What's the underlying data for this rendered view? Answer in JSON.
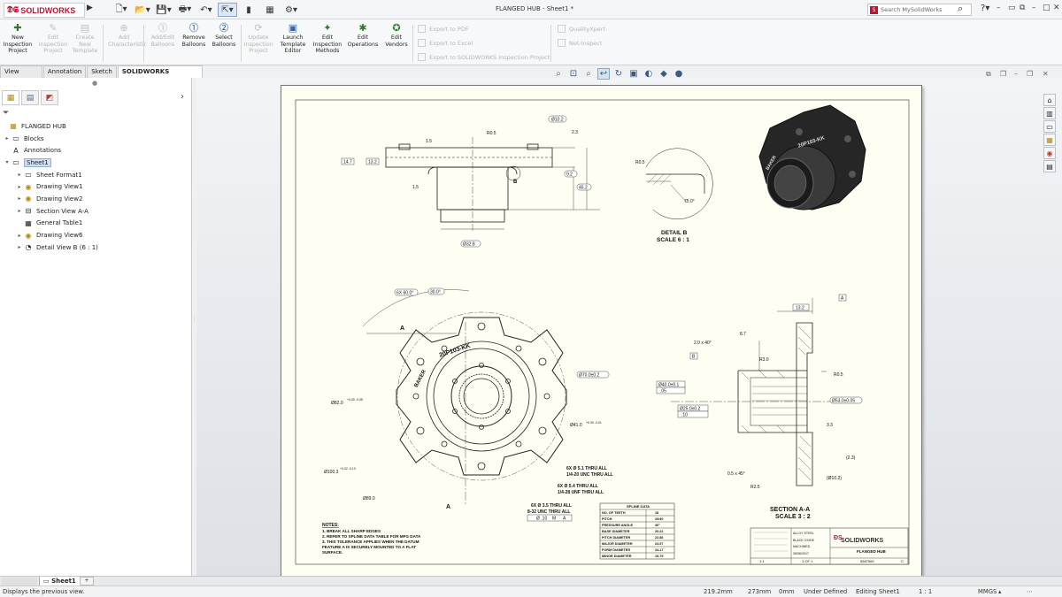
{
  "app": {
    "logo_text": "SOLIDWORKS",
    "title": "FLANGED HUB - Sheet1 *",
    "search_placeholder": "Search MySolidWorks",
    "help": "?"
  },
  "commands": [
    {
      "label": "New Inspection Project",
      "icon": "new-project-icon",
      "enabled": true
    },
    {
      "label": "Edit Inspection Project",
      "icon": "edit-project-icon",
      "enabled": false
    },
    {
      "label": "Create New Template",
      "icon": "template-icon",
      "enabled": false
    },
    {
      "label": "Add Characteristic",
      "icon": "add-char-icon",
      "enabled": false
    },
    {
      "label": "Add/Edit Balloons",
      "icon": "add-balloons-icon",
      "enabled": false
    },
    {
      "label": "Remove Balloons",
      "icon": "remove-balloons-icon",
      "enabled": true
    },
    {
      "label": "Select Balloons",
      "icon": "select-balloons-icon",
      "enabled": true
    },
    {
      "label": "Update Inspection Project",
      "icon": "update-icon",
      "enabled": false
    },
    {
      "label": "Launch Template Editor",
      "icon": "launch-icon",
      "enabled": true
    },
    {
      "label": "Edit Inspection Methods",
      "icon": "methods-icon",
      "enabled": true
    },
    {
      "label": "Edit Operations",
      "icon": "operations-icon",
      "enabled": true
    },
    {
      "label": "Edit Vendors",
      "icon": "vendors-icon",
      "enabled": true
    }
  ],
  "export": {
    "pdf": "Export to PDF",
    "excel": "Export to Excel",
    "inspection": "Export to SOLIDWORKS Inspection Project",
    "quality": "QualityXpert",
    "net": "Net-Inspect"
  },
  "tabs": [
    "View Layout",
    "Annotation",
    "Sketch",
    "SOLIDWORKS Inspection"
  ],
  "tree": [
    {
      "label": "FLANGED HUB",
      "level": 0,
      "expander": "",
      "icon": "drawing-doc-icon"
    },
    {
      "label": "Blocks",
      "level": 1,
      "expander": "▸",
      "icon": "blocks-folder-icon"
    },
    {
      "label": "Annotations",
      "level": 1,
      "expander": "",
      "icon": "annotations-icon"
    },
    {
      "label": "Sheet1",
      "level": 1,
      "expander": "▾",
      "icon": "sheet-icon",
      "selected": true
    },
    {
      "label": "Sheet Format1",
      "level": 2,
      "expander": "▸",
      "icon": "sheet-format-icon"
    },
    {
      "label": "Drawing View1",
      "level": 2,
      "expander": "▸",
      "icon": "drawing-view-icon"
    },
    {
      "label": "Drawing View2",
      "level": 2,
      "expander": "▸",
      "icon": "drawing-view-icon"
    },
    {
      "label": "Section View A-A",
      "level": 2,
      "expander": "▸",
      "icon": "section-view-icon"
    },
    {
      "label": "General Table1",
      "level": 2,
      "expander": "",
      "icon": "table-icon"
    },
    {
      "label": "Drawing View6",
      "level": 2,
      "expander": "▸",
      "icon": "drawing-view-icon"
    },
    {
      "label": "Detail View B (6 : 1)",
      "level": 2,
      "expander": "▸",
      "icon": "detail-view-icon"
    }
  ],
  "drawing": {
    "detail_title": "DETAIL B",
    "detail_scale": "SCALE 6 : 1",
    "section_title": "SECTION A-A",
    "section_scale": "SCALE 3 : 2",
    "part_number": "20P103-KK",
    "brand_text": "BAKER",
    "section_letter": "A",
    "detail_letter": "B",
    "datum": "A",
    "dims_top": [
      "Ø10.2",
      "R0.5",
      "2.3",
      "1.5",
      "14.7",
      "13.2",
      "9.2",
      "45.2",
      "Ø32.8",
      "1.5"
    ],
    "dims_front": [
      "6X 60.0°",
      "30.0°",
      "Ø70.0±0.2",
      "Ø82.0",
      "Ø41.0",
      "Ø100.3",
      "Ø89.0"
    ],
    "dims_front_tol": [
      "+0.00 -0.05",
      "+0.02 -0.10",
      "+0.00 -0.01"
    ],
    "hole_notes": [
      "6X Ø 5.1 THRU ALL",
      "1/4-20 UNC THRU ALL",
      "6X Ø 5.4 THRU ALL",
      "1/4-28 UNF THRU ALL",
      "6X Ø 3.5 THRU ALL",
      "8-32 UNC THRU ALL"
    ],
    "fcf": [
      "Ø .10",
      "M",
      "A"
    ],
    "dims_detail": [
      "R0.5",
      "75.0°"
    ],
    "dims_section": [
      "13.2",
      "8.7",
      "2.0 x 40°",
      "R3.0",
      "R0.5",
      "Ø40.0±0.1",
      ".05",
      "Ø25.0±0.2",
      ".10",
      "Ø53.0±0.05",
      "3.3",
      "(2.3)",
      "(Ø10.2)",
      "0.5 x 45°",
      "R2.5",
      "B"
    ],
    "notes_title": "NOTES:",
    "notes": [
      "1. BREAK ALL SHARP EDGES",
      "2. REFER TO SPLINE DATA TABLE FOR MFG DATA",
      "3. THIS TOLERANCE APPLIES WHEN THE DATUM",
      "   FEATURE A IS SECURELY MOUNTED TO A FLAT",
      "   SURFACE."
    ],
    "spline": {
      "title": "SPLINE DATA",
      "rows": [
        [
          "NO. OF TEETH",
          "18"
        ],
        [
          "PITCH",
          "20/40"
        ],
        [
          "PRESSURE ANGLE",
          "30°"
        ],
        [
          "BASE DIAMETER",
          "20.22"
        ],
        [
          "PITCH DIAMETER",
          "22.86"
        ],
        [
          "MAJOR DIAMETER",
          "24.57"
        ],
        [
          "FORM DIAMETER",
          "24.17"
        ],
        [
          "MINOR DIAMETER",
          "19.79"
        ]
      ]
    },
    "titleblock": {
      "brand": "SOLIDWORKS",
      "material": "ALLOY STEEL",
      "finish": "BLACK OXIDE",
      "process": "MACHINED",
      "date": "28/06/2017",
      "title": "FLANGED HUB",
      "dwg_no": "5587569",
      "rev": "C",
      "scale": "1:1",
      "sheet": "1 OF 1"
    }
  },
  "status": {
    "message": "Displays the previous view.",
    "x": "219.2mm",
    "y": "273mm",
    "z": "0mm",
    "mode": "Under Defined",
    "editing": "Editing Sheet1",
    "scale": "1 : 1",
    "units": "MMGS"
  },
  "sheet_tab": "Sheet1",
  "colors": {
    "accent": "#c8102e",
    "part": "#2b2b2b",
    "sheet": "#fffef3"
  }
}
